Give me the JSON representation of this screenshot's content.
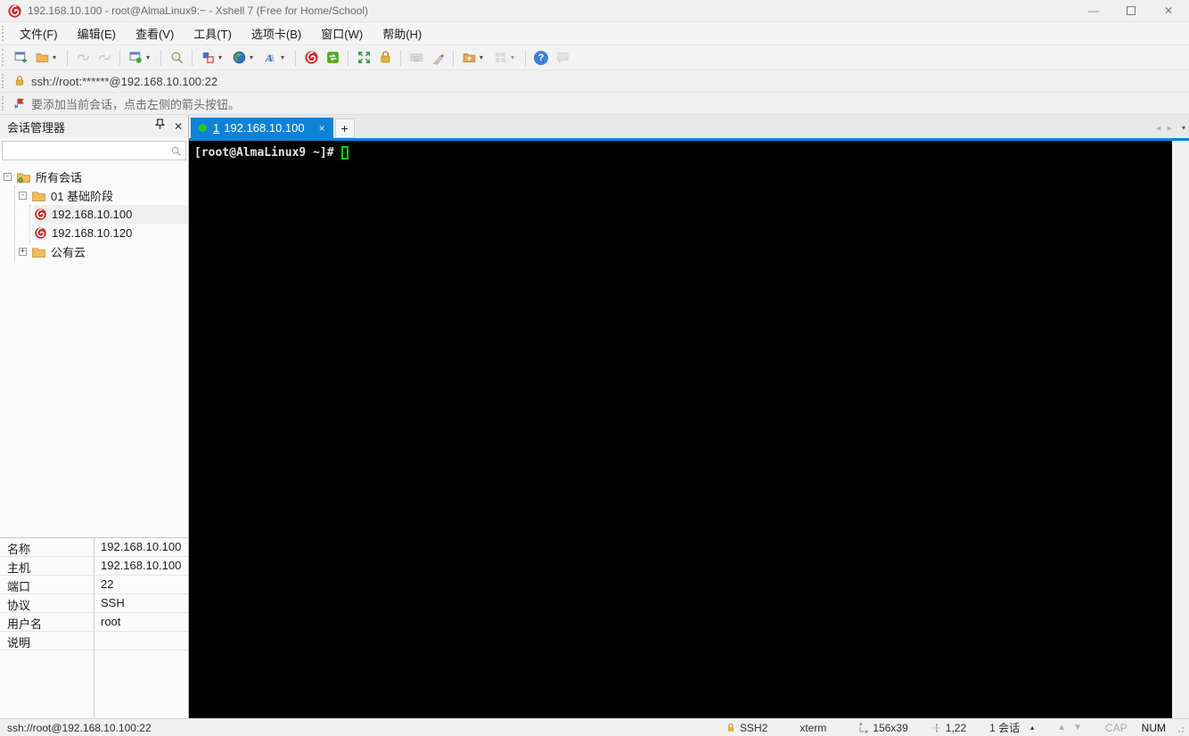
{
  "window": {
    "title": "192.168.10.100 - root@AlmaLinux9:~ - Xshell 7 (Free for Home/School)",
    "controls": {
      "minimize": "—",
      "close": "✕"
    }
  },
  "menu": {
    "items": [
      "文件(F)",
      "编辑(E)",
      "查看(V)",
      "工具(T)",
      "选项卡(B)",
      "窗口(W)",
      "帮助(H)"
    ]
  },
  "toolbar": {
    "icons": [
      "new-session",
      "open-folder",
      "disconnect",
      "reconnect",
      "session-properties",
      "find",
      "layout",
      "web-browser",
      "font",
      "xshell",
      "xftp",
      "fullscreen",
      "lock-screen",
      "virtual-keyboard",
      "highlighter",
      "new-file-transfer",
      "tile-windows",
      "help",
      "chat"
    ],
    "help_glyph": "?"
  },
  "address_bar": {
    "value": "ssh://root:******@192.168.10.100:22"
  },
  "notice_bar": {
    "text": "要添加当前会话，点击左侧的箭头按钮。"
  },
  "session_manager": {
    "title": "会话管理器",
    "tree": {
      "root": "所有会话",
      "group1": "01 基础阶段",
      "session1": "192.168.10.100",
      "session2": "192.168.10.120",
      "group2": "公有云",
      "collapse_glyph": "-",
      "expand_glyph": "+"
    },
    "properties": {
      "rows": [
        {
          "label": "名称",
          "value": "192.168.10.100"
        },
        {
          "label": "主机",
          "value": "192.168.10.100"
        },
        {
          "label": "端口",
          "value": "22"
        },
        {
          "label": "协议",
          "value": "SSH"
        },
        {
          "label": "用户名",
          "value": "root"
        },
        {
          "label": "说明",
          "value": ""
        }
      ]
    }
  },
  "tabs": {
    "active": {
      "index": "1",
      "label": "192.168.10.100"
    },
    "close_glyph": "×",
    "new_tab_glyph": "+",
    "scroll_left_glyph": "◂",
    "scroll_right_glyph": "▸",
    "list_caret_glyph": "▾"
  },
  "terminal": {
    "prompt": "[root@AlmaLinux9 ~]#"
  },
  "status_bar": {
    "left": "ssh://root@192.168.10.100:22",
    "protocol": "SSH2",
    "term_type": "xterm",
    "size": "156x39",
    "cursor_pos": "1,22",
    "sessions": "1 会话",
    "sessions_caret": "▴",
    "scroll_up_glyph": "▲",
    "scroll_down_glyph": "▼",
    "cap": "CAP",
    "num": "NUM"
  }
}
